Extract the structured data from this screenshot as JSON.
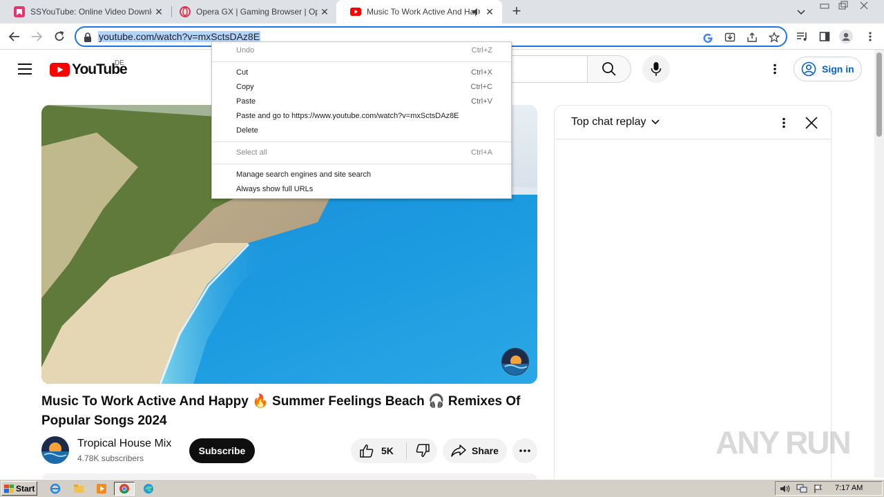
{
  "browser": {
    "tabs": [
      {
        "title": "SSYouTube: Online Video Downloader",
        "icon": "ssyoutube-icon",
        "active": false
      },
      {
        "title": "Opera GX | Gaming Browser | Opera",
        "icon": "opera-icon",
        "active": false
      },
      {
        "title": "Music To Work Active And Happy",
        "icon": "youtube-icon",
        "active": true,
        "audio": true
      }
    ],
    "url": "youtube.com/watch?v=mxSctsDAz8E"
  },
  "context_menu": {
    "items": [
      {
        "label": "Undo",
        "shortcut": "Ctrl+Z",
        "enabled": false
      },
      {
        "label": "Cut",
        "shortcut": "Ctrl+X",
        "enabled": true
      },
      {
        "label": "Copy",
        "shortcut": "Ctrl+C",
        "enabled": true
      },
      {
        "label": "Paste",
        "shortcut": "Ctrl+V",
        "enabled": true
      },
      {
        "label": "Paste and go to https://www.youtube.com/watch?v=mxSctsDAz8E",
        "shortcut": "",
        "enabled": true
      },
      {
        "label": "Delete",
        "shortcut": "",
        "enabled": true
      },
      {
        "label": "Select all",
        "shortcut": "Ctrl+A",
        "enabled": false
      },
      {
        "label": "Manage search engines and site search",
        "shortcut": "",
        "enabled": true
      },
      {
        "label": "Always show full URLs",
        "shortcut": "",
        "enabled": true
      }
    ]
  },
  "youtube": {
    "logo_text": "YouTube",
    "country": "DE",
    "signin_label": "Sign in",
    "video": {
      "title": "Music To Work Active And Happy 🔥 Summer Feelings Beach 🎧 Remixes Of Popular Songs 2024",
      "channel": "Tropical House Mix",
      "subscribers": "4.78K subscribers",
      "subscribe_label": "Subscribe",
      "likes": "5K",
      "share_label": "Share"
    },
    "chat": {
      "title": "Top chat replay"
    }
  },
  "watermark": "ANY RUN",
  "taskbar": {
    "start_label": "Start",
    "clock": "7:17 AM"
  },
  "colors": {
    "accent": "#1a73e8",
    "youtube_red": "#ff0000",
    "link_blue": "#065fd4"
  }
}
